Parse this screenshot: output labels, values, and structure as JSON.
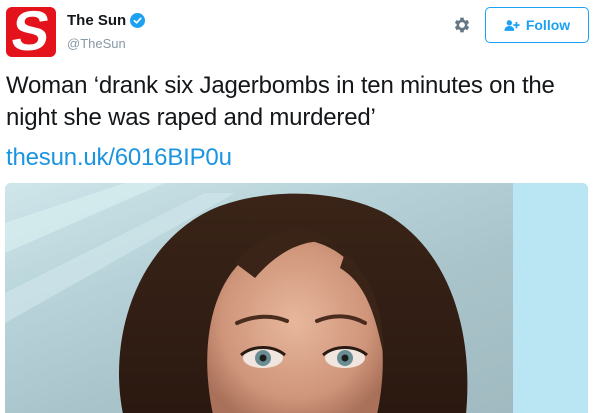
{
  "account": {
    "display_name": "The Sun",
    "handle": "@TheSun",
    "avatar_letter": "S",
    "avatar_color": "#e4121b",
    "verified": true
  },
  "follow_button": {
    "label": "Follow"
  },
  "tweet": {
    "text": "Woman ‘drank six Jagerbombs in ten minutes on the night she was raped and murdered’",
    "link": "thesun.uk/6016BIP0u"
  },
  "icons": [
    "verified-badge-icon",
    "gear-icon",
    "follow-user-icon"
  ],
  "colors": {
    "accent": "#1da1f2",
    "link": "#1b95e0",
    "text": "#14171a",
    "muted": "#8899a6"
  }
}
